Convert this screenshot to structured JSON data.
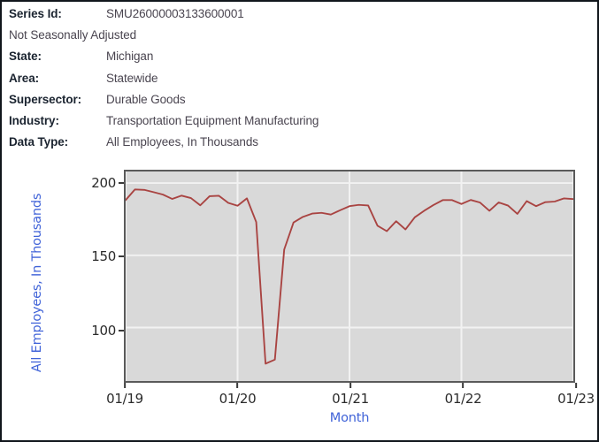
{
  "meta": {
    "rows": [
      {
        "label": "Series Id:",
        "value": "SMU26000003133600001"
      },
      {
        "label": "",
        "value": "Not Seasonally Adjusted"
      },
      {
        "label": "State:",
        "value": "Michigan"
      },
      {
        "label": "Area:",
        "value": "Statewide"
      },
      {
        "label": "Supersector:",
        "value": "Durable Goods"
      },
      {
        "label": "Industry:",
        "value": "Transportation Equipment Manufacturing"
      },
      {
        "label": "Data Type:",
        "value": "All Employees, In Thousands"
      }
    ]
  },
  "colors": {
    "line": "#a94442",
    "plot_background": "#d9d9d9",
    "plot_border": "#5a5a5a",
    "gridline": "#f2f2f2",
    "axis_title": "#4063d8",
    "tick_text": "#2b2b2b",
    "meta_label": "#1b2430",
    "meta_value": "#4a4550",
    "frame": "#11161c"
  },
  "chart_data": {
    "type": "line",
    "title": "",
    "xlabel": "Month",
    "ylabel": "All Employees, In Thousands",
    "xlim": [
      "01/19",
      "01/23"
    ],
    "ylim": [
      63,
      208
    ],
    "yticks": [
      100,
      150,
      200
    ],
    "xticks": [
      "01/19",
      "01/20",
      "01/21",
      "01/22",
      "01/23"
    ],
    "grid": true,
    "legend": "none",
    "series": [
      {
        "name": "All Employees, In Thousands",
        "x": [
          "01/19",
          "02/19",
          "03/19",
          "04/19",
          "05/19",
          "06/19",
          "07/19",
          "08/19",
          "09/19",
          "10/19",
          "11/19",
          "12/19",
          "01/20",
          "02/20",
          "03/20",
          "04/20",
          "05/20",
          "06/20",
          "07/20",
          "08/20",
          "09/20",
          "10/20",
          "11/20",
          "12/20",
          "01/21",
          "02/21",
          "03/21",
          "04/21",
          "05/21",
          "06/21",
          "07/21",
          "08/21",
          "09/21",
          "10/21",
          "11/21",
          "12/21",
          "01/22",
          "02/22",
          "03/22",
          "04/22",
          "05/22",
          "06/22",
          "07/22",
          "08/22",
          "09/22",
          "10/22",
          "11/22",
          "12/22",
          "01/23"
        ],
        "values": [
          188.2,
          195.6,
          195.3,
          193.7,
          192.0,
          189.0,
          191.3,
          189.6,
          184.6,
          190.9,
          191.2,
          186.3,
          184.3,
          189.4,
          173.0,
          75.0,
          77.8,
          154.0,
          172.7,
          176.6,
          178.9,
          179.4,
          178.2,
          181.2,
          184.0,
          184.9,
          184.5,
          170.5,
          166.7,
          173.6,
          167.9,
          176.3,
          180.8,
          184.8,
          188.2,
          188.2,
          185.5,
          188.3,
          186.5,
          180.8,
          186.6,
          184.4,
          178.7,
          187.5,
          184.0,
          186.8,
          187.2,
          189.4,
          188.9
        ]
      }
    ]
  }
}
